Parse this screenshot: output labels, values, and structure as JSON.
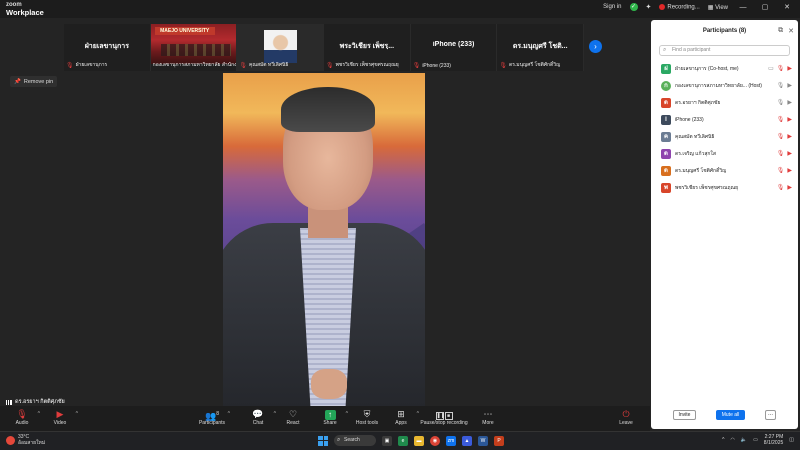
{
  "title_bar": {
    "logo_line1": "zoom",
    "logo_line2": "Workplace",
    "sign_in": "Sign in",
    "recording": "Recording...",
    "view": "View"
  },
  "gallery": {
    "tiles": [
      {
        "big": "ฝ่ายเลขานุการ",
        "label": "ฝ่ายเลขานุการ"
      },
      {
        "big": "",
        "label": "กองเลขานุการสภามหาวิทยาลัย สำนักงาน",
        "banner": "MAEJO UNIVERSITY"
      },
      {
        "big": "",
        "label": "คุณสมัต ทวีเลิศนิธิ"
      },
      {
        "big": "พระวิเชียร เพ็ชรฺ...",
        "label": "พชรวิเชียร เพ็ชรศุขศรณฤณยุ"
      },
      {
        "big": "iPhone (233)",
        "label": "iPhone (233)"
      },
      {
        "big": "ดร.มนุญศรี โชติ...",
        "label": "ดร.มนุญศรี โชติศักดิ์วิญ"
      }
    ]
  },
  "remove_pin": "Remove pin",
  "speaker_name": "ดร.อรยาฯ กิตติศุภชัย",
  "toolbar": {
    "audio": "Audio",
    "video": "Video",
    "participants": "Participants",
    "participants_count": "8",
    "chat": "Chat",
    "react": "React",
    "share": "Share",
    "host_tools": "Host tools",
    "apps": "Apps",
    "pause_recording": "Pause/stop recording",
    "more": "More",
    "leave": "Leave"
  },
  "panel": {
    "title": "Participants (8)",
    "search_placeholder": "Find a participant",
    "participants": [
      {
        "initial": "ฝ",
        "name": "ฝ่ายเลขานุการ (Co-host, me)",
        "color": "#2aa863"
      },
      {
        "initial": "ก",
        "name": "กองเลขานุการสภามหาวิทยาลัย... (Host)",
        "color": "#5ab05a"
      },
      {
        "initial": "ด",
        "name": "ดร.อรยาฯ กิตติศุภชัย",
        "color": "#d8452a"
      },
      {
        "initial": "I",
        "name": "iPhone (233)",
        "color": "#3d4a5c"
      },
      {
        "initial": "ค",
        "name": "คุณสมัต ทวีเลิศนิธิ",
        "color": "#6b7c93"
      },
      {
        "initial": "ด",
        "name": "ดร.เจริญ แก้วสุกใส",
        "color": "#8e44ad"
      },
      {
        "initial": "ด",
        "name": "ดร.มนุญศรี โชติศักดิ์วิญ",
        "color": "#d86f1e"
      },
      {
        "initial": "พ",
        "name": "พชรวิเชียร เพ็ชรศุขศรณฤณยุ",
        "color": "#d8452a"
      }
    ],
    "invite": "Invite",
    "mute_all": "Mute all",
    "more": "..."
  },
  "taskbar": {
    "temp": "33°C",
    "location": "อ้อมสายใหม่",
    "search": "Search",
    "time": "2:27 PM",
    "date": "8/1/2025"
  },
  "colors": {
    "accent": "#0e72ed",
    "danger": "#e03c3c",
    "panel_bg": "#ffffff",
    "app_bg": "#242424"
  }
}
